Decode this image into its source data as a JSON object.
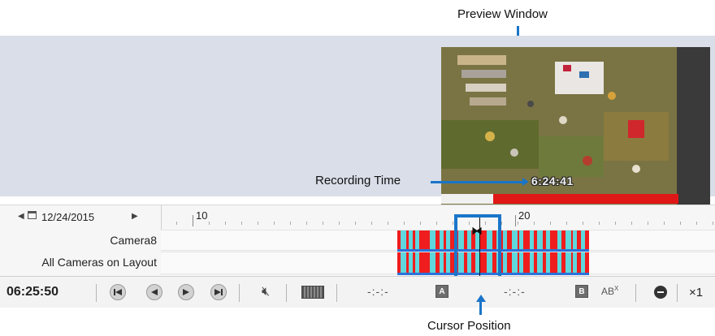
{
  "callouts": {
    "preview_window": "Preview Window",
    "recording_time": "Recording Time",
    "cursor_position": "Cursor Position"
  },
  "preview": {
    "recording_time_text": "6:24:41",
    "progress_fraction": 0.22
  },
  "timeline": {
    "date": "12/24/2015",
    "prev_date_icon": "left-triangle-icon",
    "next_date_icon": "right-triangle-icon",
    "calendar_icon": "calendar-icon",
    "ruler_labels": [
      "10",
      "20"
    ],
    "tracks": [
      {
        "label": "Camera8"
      },
      {
        "label": "All Cameras on Layout"
      }
    ]
  },
  "controls": {
    "time": "06:25:50",
    "buttons": [
      "skip-back-icon",
      "step-back-icon",
      "play-icon",
      "skip-forward-icon"
    ],
    "mute_icon": "mute-icon",
    "filmstrip_icon": "filmstrip-icon",
    "mark_a_text": "-:-:-",
    "mark_a_label": "A",
    "mark_b_text": "-:-:-",
    "mark_b_label": "B",
    "ab_label": "AB",
    "ab_sup": "X",
    "speed": "×1"
  },
  "colors": {
    "accent_blue": "#1a75c9",
    "recording_red": "#ef1d1d",
    "motion_cyan": "#5fd7dc"
  }
}
